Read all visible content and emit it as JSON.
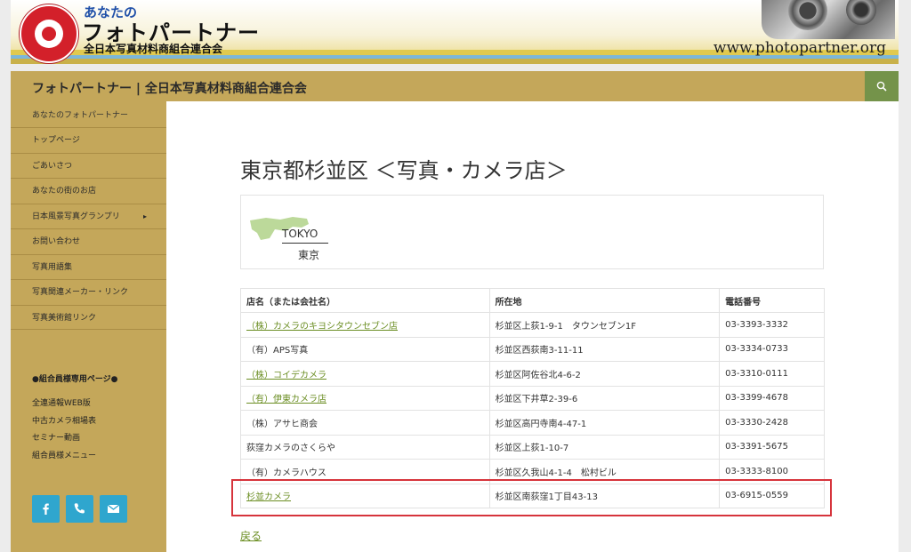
{
  "banner": {
    "small_text": "あなたの",
    "big_text": "フォトパートナー",
    "sub_text": "全日本写真材料商組合連合会",
    "url_text": "www.photopartner.org"
  },
  "header": {
    "site_title": "フォトパートナー | 全日本写真材料商組合連合会"
  },
  "sidebar": {
    "tagline": "あなたのフォトパートナー",
    "items": [
      {
        "label": "トップページ"
      },
      {
        "label": "ごあいさつ"
      },
      {
        "label": "あなたの街のお店"
      },
      {
        "label": "日本風景写真グランプリ",
        "chevron": "▸"
      },
      {
        "label": "お問い合わせ"
      },
      {
        "label": "写真用語集"
      },
      {
        "label": "写真関連メーカー・リンク"
      },
      {
        "label": "写真美術館リンク"
      }
    ],
    "members_title": "●組合員様専用ページ●",
    "members_links": [
      "全連通報WEB版",
      "中古カメラ相場表",
      "セミナー動画",
      "組合員様メニュー"
    ],
    "social": [
      "facebook-icon",
      "phone-icon",
      "mail-icon"
    ]
  },
  "main": {
    "title": "東京都杉並区 ＜写真・カメラ店＞",
    "region_en": "TOKYO",
    "region_jp": "東京",
    "table": {
      "headers": [
        "店名（または会社名）",
        "所在地",
        "電話番号"
      ],
      "rows": [
        {
          "name": "（株）カメラのキヨシタウンセブン店",
          "address": "杉並区上荻1-9-1　タウンセブン1F",
          "phone": "03-3393-3332",
          "link": true
        },
        {
          "name": "（有）APS写真",
          "address": "杉並区西荻南3-11-11",
          "phone": "03-3334-0733",
          "link": false
        },
        {
          "name": "（株）コイデカメラ",
          "address": "杉並区阿佐谷北4-6-2",
          "phone": "03-3310-0111",
          "link": true
        },
        {
          "name": "（有）伊東カメラ店",
          "address": "杉並区下井草2-39-6",
          "phone": "03-3399-4678",
          "link": true
        },
        {
          "name": "（株）アサヒ商会",
          "address": "杉並区高円寺南4-47-1",
          "phone": "03-3330-2428",
          "link": false
        },
        {
          "name": "荻窪カメラのさくらや",
          "address": "杉並区上荻1-10-7",
          "phone": "03-3391-5675",
          "link": false
        },
        {
          "name": "（有）カメラハウス",
          "address": "杉並区久我山4-1-4　松村ビル",
          "phone": "03-3333-8100",
          "link": false
        },
        {
          "name": "杉並カメラ",
          "address": "杉並区南荻窪1丁目43-13",
          "phone": "03-6915-0559",
          "link": true
        }
      ]
    },
    "back_label": "戻る"
  },
  "colors": {
    "sidebar_bg": "#c4a75a",
    "search_bg": "#74934a",
    "link": "#6b8e23",
    "social_bg": "#2fa6ce",
    "highlight": "#d6343c"
  }
}
